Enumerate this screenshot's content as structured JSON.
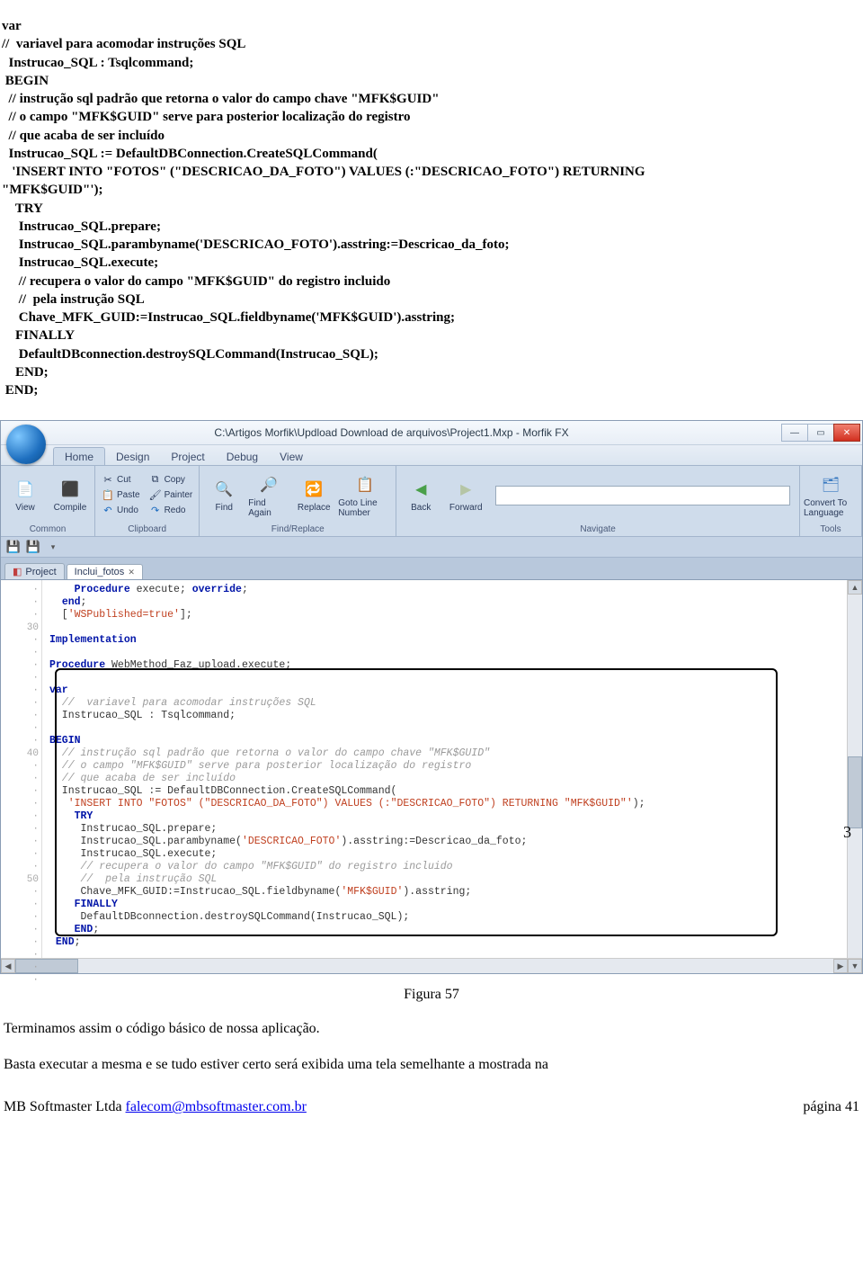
{
  "code_top": "var\n//  variavel para acomodar instruções SQL\n  Instrucao_SQL : Tsqlcommand;\n BEGIN\n  // instrução sql padrão que retorna o valor do campo chave \"MFK$GUID\"\n  // o campo \"MFK$GUID\" serve para posterior localização do registro\n  // que acaba de ser incluído\n  Instrucao_SQL := DefaultDBConnection.CreateSQLCommand(\n   'INSERT INTO \"FOTOS\" (\"DESCRICAO_DA_FOTO\") VALUES (:\"DESCRICAO_FOTO\") RETURNING\n\"MFK$GUID\"');\n    TRY\n     Instrucao_SQL.prepare;\n     Instrucao_SQL.parambyname('DESCRICAO_FOTO').asstring:=Descricao_da_foto;\n     Instrucao_SQL.execute;\n     // recupera o valor do campo \"MFK$GUID\" do registro incluido\n     //  pela instrução SQL\n     Chave_MFK_GUID:=Instrucao_SQL.fieldbyname('MFK$GUID').asstring;\n    FINALLY\n     DefaultDBconnection.destroySQLCommand(Instrucao_SQL);\n    END;\n END;",
  "ide": {
    "title": "C:\\Artigos Morfik\\Updload Download de arquivos\\Project1.Mxp - Morfik FX",
    "tabs": [
      "Home",
      "Design",
      "Project",
      "Debug",
      "View"
    ],
    "groups": {
      "common": "Common",
      "clipboard": "Clipboard",
      "findreplace": "Find/Replace",
      "navigate": "Navigate",
      "tools": "Tools"
    },
    "buttons": {
      "view": "View",
      "compile": "Compile",
      "cut": "Cut",
      "copy": "Copy",
      "paste": "Paste",
      "painter": "Painter",
      "undo": "Undo",
      "redo": "Redo",
      "find": "Find",
      "find_again": "Find Again",
      "replace": "Replace",
      "goto": "Goto Line Number",
      "back": "Back",
      "forward": "Forward",
      "convert": "Convert To Language"
    },
    "doc_tabs": {
      "project": "Project",
      "current": "Inclui_fotos"
    }
  },
  "callout": "3",
  "caption": "Figura 57",
  "para1": "Terminamos assim o código básico de nossa aplicação.",
  "para2": "Basta executar a mesma e se tudo estiver certo será exibida uma tela semelhante  a mostrada na",
  "footer": {
    "left_prefix": "MB Softmaster Ltda ",
    "left_link": "falecom@mbsoftmaster.com.br",
    "right": "página   41"
  }
}
